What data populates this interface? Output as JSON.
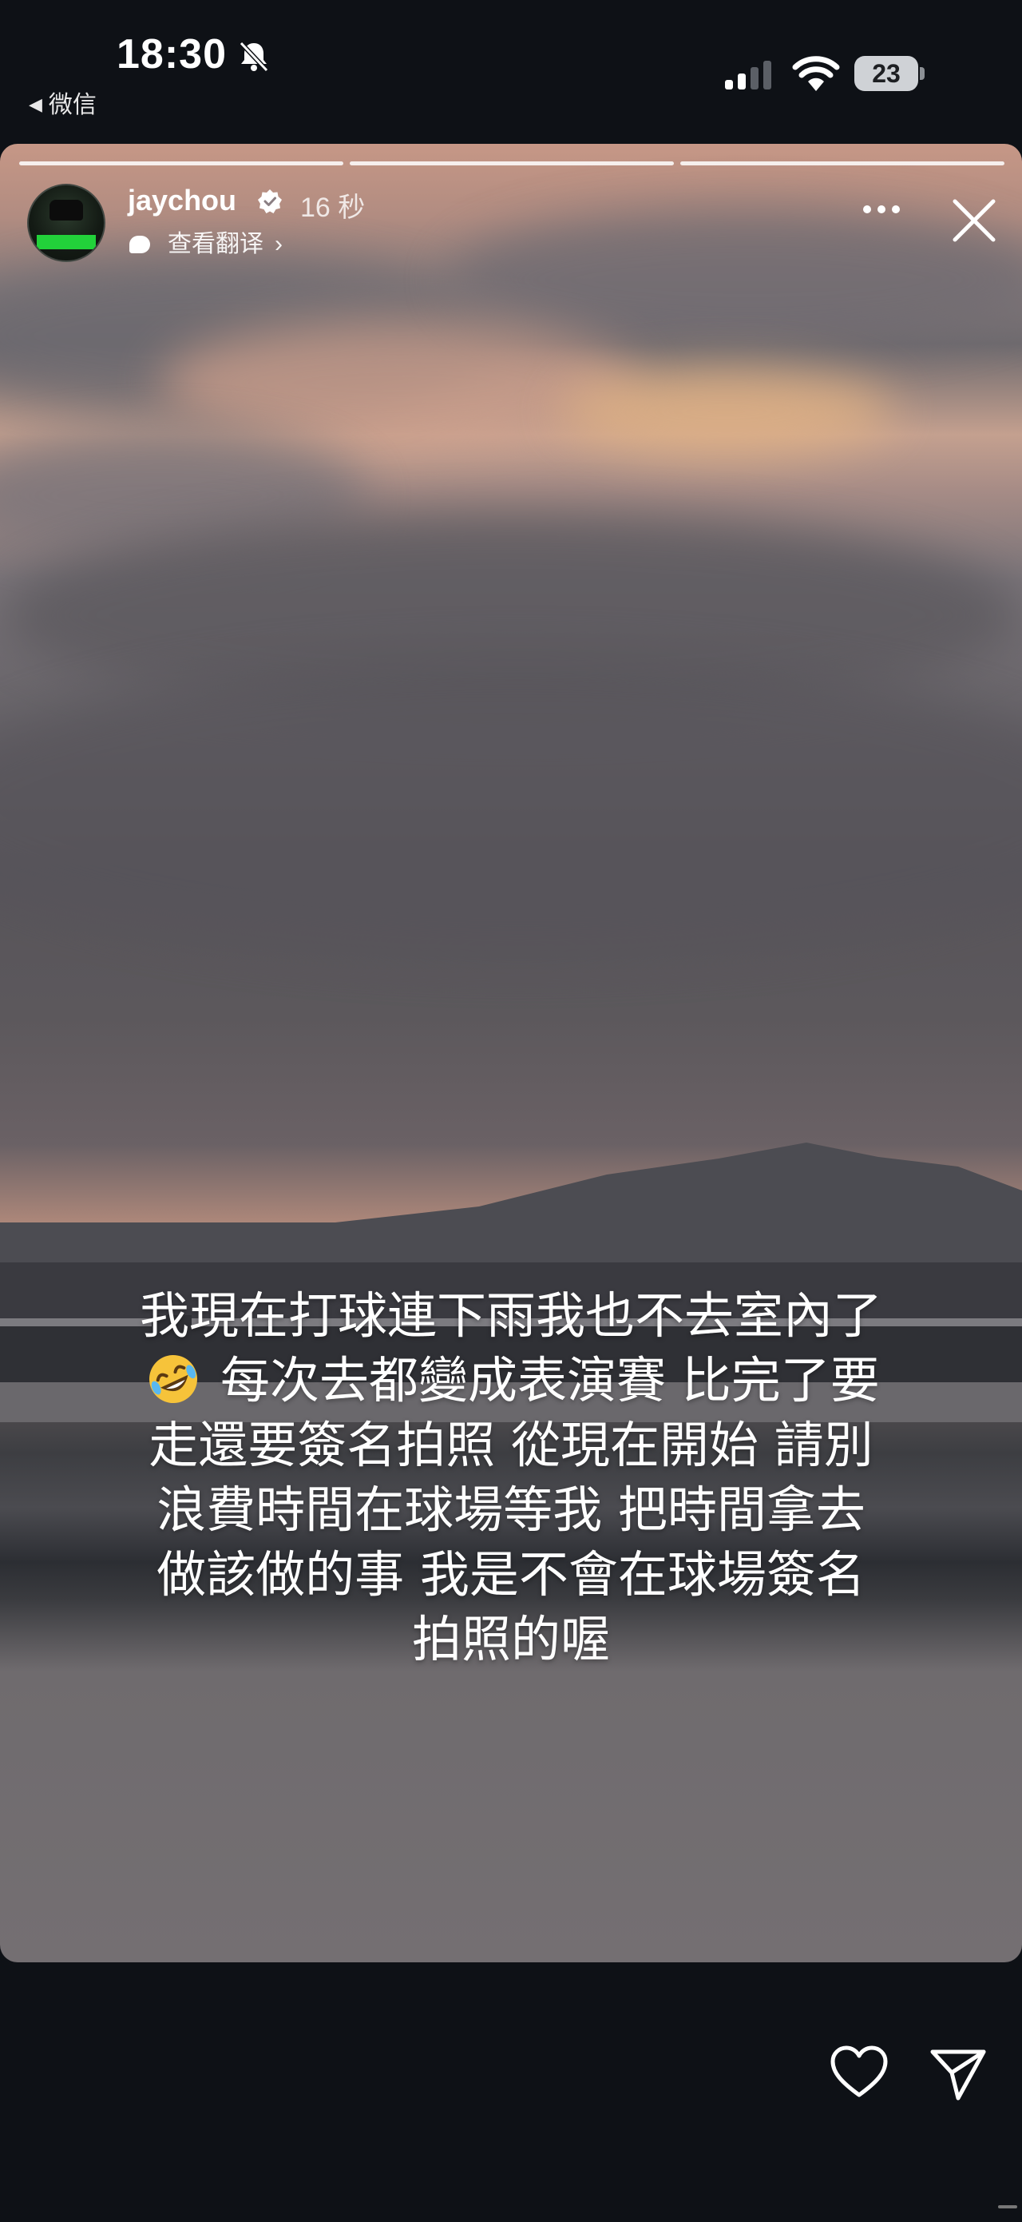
{
  "status_bar": {
    "time": "18:30",
    "back_app": "微信",
    "battery": "23"
  },
  "story": {
    "username": "jaychou",
    "time_ago": "16 秒",
    "translate_label": "查看翻译",
    "caption_before_emoji": "我現在打球連下雨我也不去室內了",
    "caption_emoji": "rolling-on-floor-laughing-emoji",
    "caption_after_emoji": " 每次去都變成表演賽 比完了要走還要簽名拍照 從現在開始  請別浪費時間在球場等我 把時間拿去做該做的事 我是不會在球場簽名拍照的喔"
  },
  "icons": {
    "more": "more-icon",
    "close": "close-icon",
    "like": "heart-icon",
    "share": "send-icon"
  },
  "colors": {
    "background": "#0e1116",
    "sky_peach": "#c49888",
    "verified": "#ffffff"
  }
}
